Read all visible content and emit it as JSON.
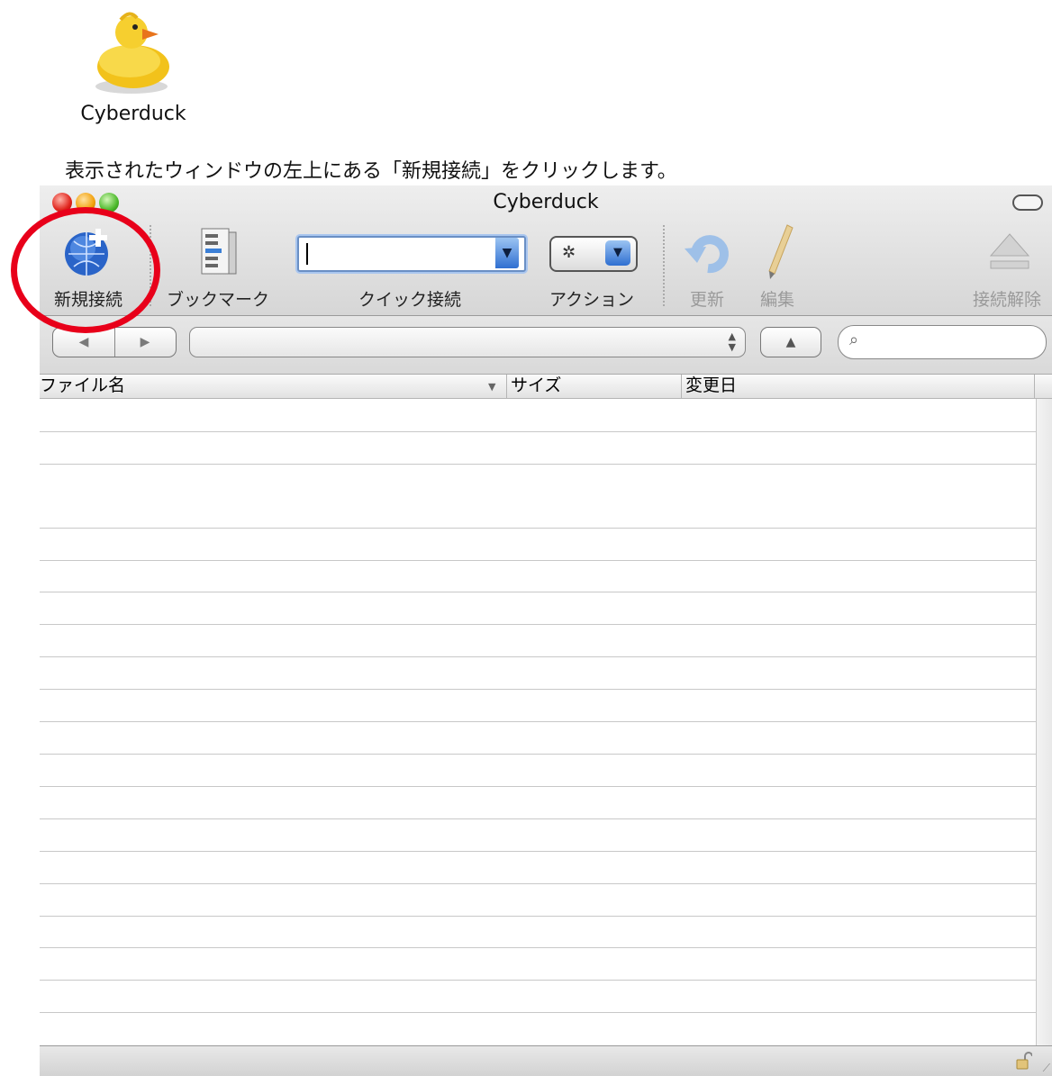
{
  "desktop": {
    "app_icon_label": "Cyberduck"
  },
  "instruction": "表示されたウィンドウの左上にある「新規接続」をクリックします。",
  "window": {
    "title": "Cyberduck"
  },
  "toolbar": {
    "new_connection": "新規接続",
    "bookmark": "ブックマーク",
    "quick_connect": "クイック接続",
    "quick_connect_value": "",
    "action": "アクション",
    "refresh": "更新",
    "edit": "編集",
    "disconnect": "接続解除"
  },
  "columns": {
    "name": "ファイル名",
    "size": "サイズ",
    "modified": "変更日"
  },
  "annotation": {
    "color": "#e8001a",
    "target": "new-connection-button"
  }
}
